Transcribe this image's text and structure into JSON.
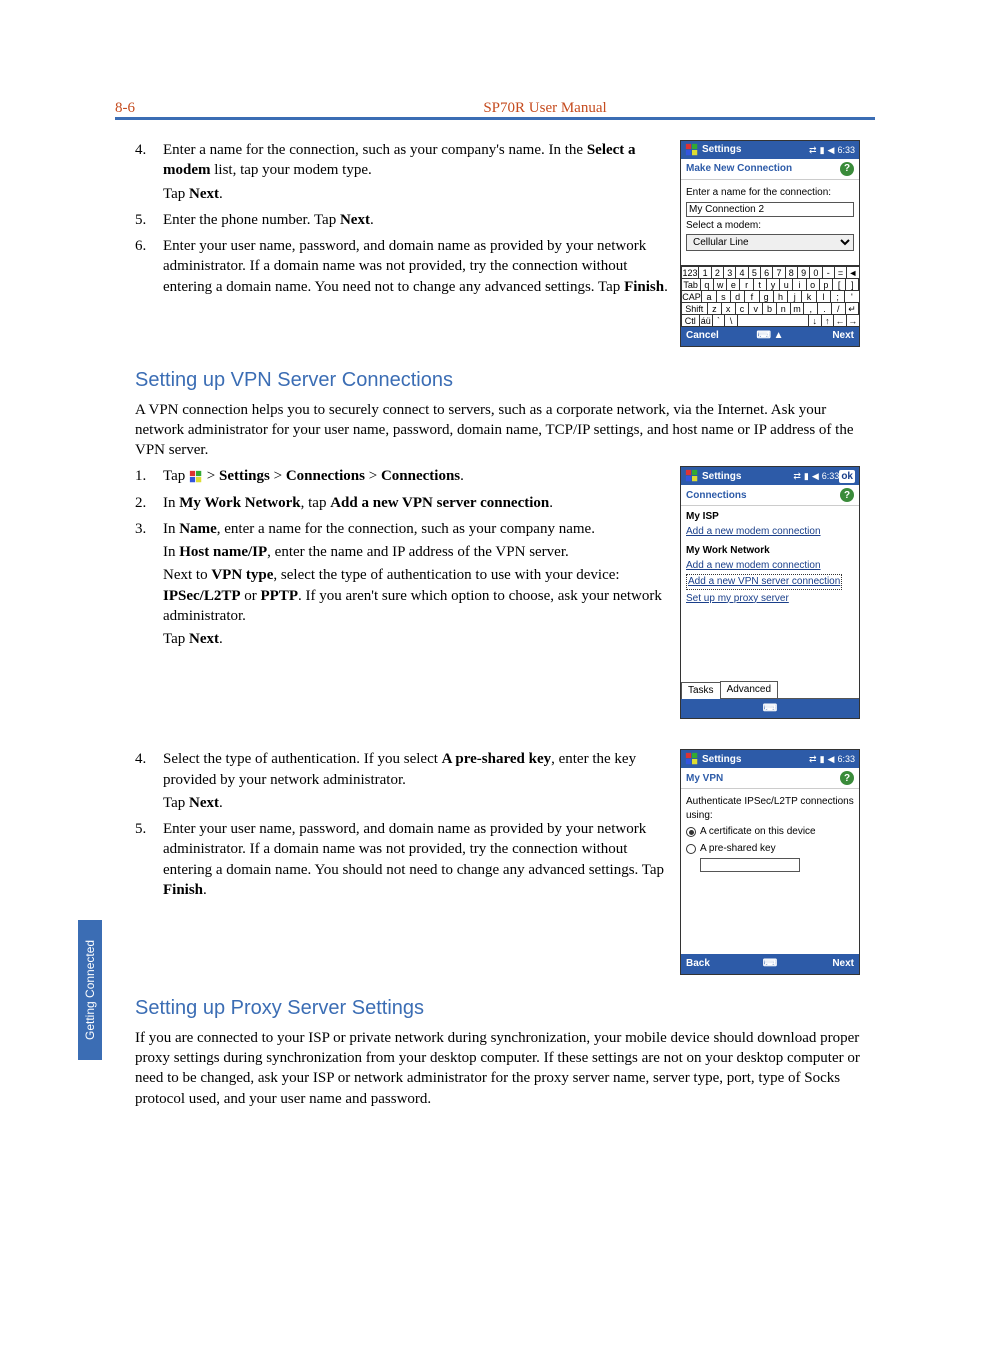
{
  "header": {
    "page_num": "8-6",
    "title": "SP70R User Manual"
  },
  "side_tab": "Getting Connected",
  "sec1": {
    "items": [
      {
        "n": "4.",
        "body_pre": "Enter a name for the connection, such as your company's name. In the ",
        "bold1": "Select a modem",
        "mid": " list, tap your modem type.",
        "line2_pre": "Tap ",
        "line2_b": "Next",
        "line2_post": "."
      },
      {
        "n": "5.",
        "body_pre": "Enter the phone number. Tap ",
        "bold1": "Next",
        "post": "."
      },
      {
        "n": "6.",
        "body": "Enter your user name, password, and domain name as provided by your network administrator. If a domain name was not provided, try the connection without entering a domain name. You need not to change any advanced settings. Tap ",
        "bold1": "Finish",
        "post": "."
      }
    ]
  },
  "device1": {
    "title": "Settings",
    "time": "6:33",
    "subtitle": "Make New Connection",
    "label1": "Enter a name for the connection:",
    "input1": "My Connection 2",
    "label2": "Select a modem:",
    "select1": "Cellular Line",
    "kbd": {
      "r1": [
        "123",
        "1",
        "2",
        "3",
        "4",
        "5",
        "6",
        "7",
        "8",
        "9",
        "0",
        "-",
        "=",
        "◄"
      ],
      "r2": [
        "Tab",
        "q",
        "w",
        "e",
        "r",
        "t",
        "y",
        "u",
        "i",
        "o",
        "p",
        "[",
        "]"
      ],
      "r3": [
        "CAP",
        "a",
        "s",
        "d",
        "f",
        "g",
        "h",
        "j",
        "k",
        "l",
        ";",
        "'"
      ],
      "r4": [
        "Shift",
        "z",
        "x",
        "c",
        "v",
        "b",
        "n",
        "m",
        ",",
        ".",
        "/",
        "↵"
      ],
      "r5": [
        "Ctl",
        "áü",
        "`",
        "\\",
        "",
        "↓",
        "↑",
        "←",
        "→"
      ]
    },
    "foot": {
      "left": "Cancel",
      "center_icon": "⌨ ▲",
      "right": "Next"
    }
  },
  "sec2": {
    "heading": "Setting up VPN Server Connections",
    "intro": "A VPN connection helps you to securely connect to servers, such as a corporate network, via the Internet. Ask your network administrator for your user name, password, domain name, TCP/IP settings, and host name or IP address of the VPN server.",
    "items1": [
      {
        "n": "1.",
        "pre": "Tap ",
        "icon": true,
        "post1": " > ",
        "b1": "Settings",
        "post2": " > ",
        "b2": "Connections",
        "post3": " > ",
        "b3": "Connections",
        "post4": "."
      },
      {
        "n": "2.",
        "pre": "In ",
        "b1": "My Work Network",
        "mid": ", tap ",
        "b2": "Add a new VPN server connection",
        "post": "."
      },
      {
        "n": "3.",
        "pre": "In ",
        "b1": "Name",
        "post": ", enter a name for the connection, such as your company name.",
        "p2_pre": "In ",
        "p2_b": "Host name/IP",
        "p2_post": ", enter the name and IP address of the  VPN server.",
        "p3_pre": "Next to ",
        "p3_b1": "VPN type",
        "p3_mid": ", select the type of authentication to use with your device: ",
        "p3_b2": "IPSec/L2TP",
        "p3_mid2": " or ",
        "p3_b3": "PPTP",
        "p3_post": ". If you aren't sure which option to choose, ask your network administrator.",
        "p4_pre": "Tap ",
        "p4_b": "Next",
        "p4_post": "."
      }
    ],
    "items2": [
      {
        "n": "4.",
        "pre": "Select the type of authentication. If you select ",
        "b1": "A pre-shared key",
        "mid": ", enter the key provided by your network administrator.",
        "p2_pre": "Tap ",
        "p2_b": "Next",
        "p2_post": "."
      },
      {
        "n": "5.",
        "body": "Enter your user name, password, and domain name as provided by your network administrator. If a domain name was not provided, try the connection without entering a domain name. You should not need to change any advanced settings. Tap ",
        "b1": "Finish",
        "post": "."
      }
    ]
  },
  "device2": {
    "title": "Settings",
    "time": "6:33",
    "ok": "ok",
    "subtitle": "Connections",
    "g1_title": "My ISP",
    "g1_link": "Add a new modem connection",
    "g2_title": "My Work Network",
    "g2_link1": "Add a new modem connection",
    "g2_link2": "Add a new VPN server connection",
    "g2_link3": "Set up my proxy server",
    "tabs": [
      "Tasks",
      "Advanced"
    ],
    "foot_center": "⌨"
  },
  "device3": {
    "title": "Settings",
    "time": "6:33",
    "subtitle": "My VPN",
    "label": "Authenticate IPSec/L2TP connections using:",
    "opt1": "A certificate on this device",
    "opt2": "A pre-shared key",
    "foot": {
      "left": "Back",
      "center": "⌨",
      "right": "Next"
    }
  },
  "sec3": {
    "heading": "Setting up Proxy Server Settings",
    "body": "If you are connected to your ISP or private network during synchronization, your mobile device should download proper proxy settings during synchronization from your desktop computer. If these settings are not on your desktop computer or need to be changed, ask your ISP or network administrator for the proxy server name, server type, port, type of Socks protocol used, and your user name and password."
  }
}
